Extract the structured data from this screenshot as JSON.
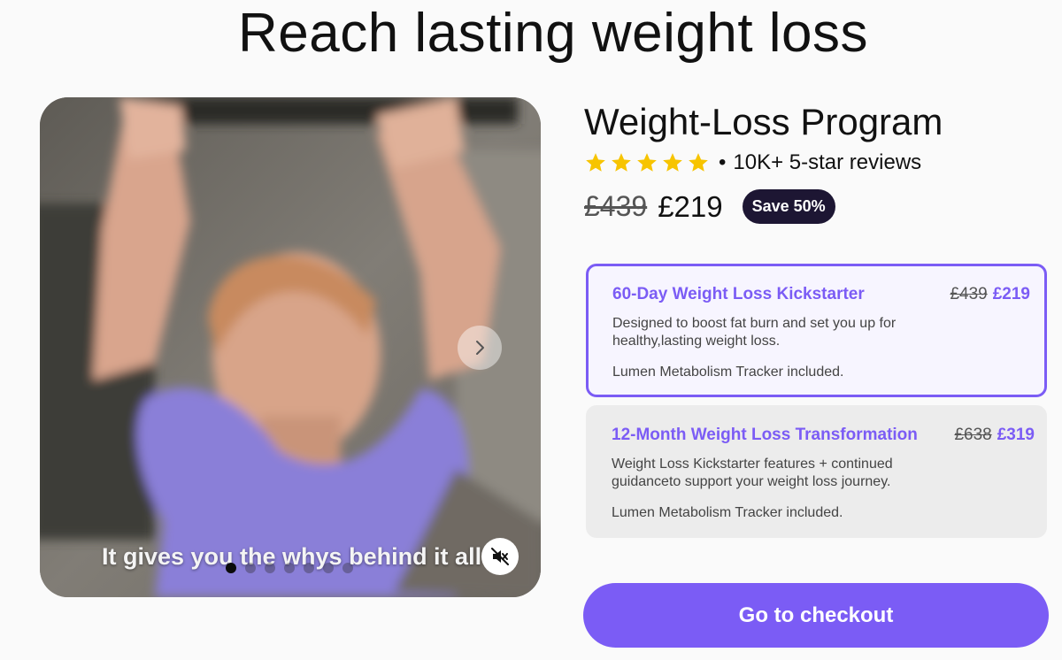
{
  "page": {
    "title": "Reach lasting weight loss"
  },
  "media": {
    "caption": "It gives you the whys behind it all",
    "next_icon": "chevron-right-icon",
    "mute_icon": "speaker-muted-icon",
    "slide_count": 7,
    "active_slide": 1
  },
  "product": {
    "title": "Weight-Loss Program",
    "stars": 5,
    "reviews_text": "10K+ 5-star reviews",
    "old_price": "£439",
    "new_price": "£219",
    "save_badge": "Save 50%"
  },
  "plans": [
    {
      "name": "60-Day Weight Loss Kickstarter",
      "old_price": "£439",
      "new_price": "£219",
      "description": "Designed to boost fat burn and set you up for healthy,lasting weight loss.",
      "extra": "Lumen Metabolism Tracker included.",
      "selected": true
    },
    {
      "name": "12-Month Weight Loss Transformation",
      "old_price": "£638",
      "new_price": "£319",
      "description": "Weight Loss Kickstarter features + continued guidanceto support your weight loss journey.",
      "extra": "Lumen Metabolism Tracker included.",
      "selected": false
    }
  ],
  "checkout": {
    "label": "Go to checkout"
  },
  "colors": {
    "accent": "#7b5cf5",
    "badge_bg": "#1d1633",
    "star": "#f7c400",
    "shirt": "#8a7fd8"
  }
}
